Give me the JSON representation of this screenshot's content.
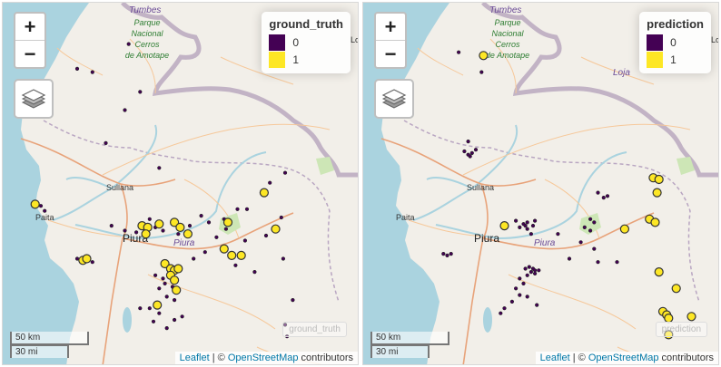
{
  "zoom": {
    "in_label": "+",
    "out_label": "−"
  },
  "scale": {
    "km": "50 km",
    "mi": "30 mi"
  },
  "attribution": {
    "leaflet": "Leaflet",
    "sep": " | © ",
    "osm": "OpenStreetMap",
    "suffix": " contributors"
  },
  "place_labels": {
    "tumbes": "Tumbes",
    "park": [
      "Parque",
      "Nacional",
      "Cerros",
      "de Amotape"
    ],
    "sullana": "Sullana",
    "paita": "Paita",
    "piura_city": "Piura",
    "piura_region": "Piura",
    "loja": "Loja",
    "lo": "Lo"
  },
  "colors": {
    "class_0": "#440154",
    "class_1": "#fde725",
    "accent": "#0078a8"
  },
  "maps": [
    {
      "name": "ground-truth",
      "legend_title": "ground_truth",
      "legend_items": [
        {
          "label": "0",
          "color": "#440154"
        },
        {
          "label": "1",
          "color": "#fde725"
        }
      ],
      "watermark": "ground_truth",
      "points_class_1": [
        [
          -4.77,
          -81.35
        ],
        [
          -4.88,
          -80.62
        ],
        [
          -4.9,
          -80.79
        ],
        [
          -4.91,
          -80.76
        ],
        [
          -4.89,
          -80.7
        ],
        [
          -4.95,
          -80.77
        ],
        [
          -4.91,
          -80.59
        ],
        [
          -4.95,
          -80.55
        ],
        [
          -4.88,
          -80.34
        ],
        [
          -4.7,
          -80.15
        ],
        [
          -5.11,
          -81.1
        ],
        [
          -5.1,
          -81.08
        ],
        [
          -5.04,
          -80.36
        ],
        [
          -5.08,
          -80.32
        ],
        [
          -5.08,
          -80.27
        ],
        [
          -5.13,
          -80.67
        ],
        [
          -5.16,
          -80.64
        ],
        [
          -5.17,
          -80.62
        ],
        [
          -5.16,
          -80.6
        ],
        [
          -5.2,
          -80.64
        ],
        [
          -5.23,
          -80.62
        ],
        [
          -5.29,
          -80.61
        ],
        [
          -5.38,
          -80.71
        ],
        [
          -4.92,
          -80.09
        ]
      ],
      "points_class_0": [
        [
          -3.8,
          -80.86
        ],
        [
          -3.95,
          -81.13
        ],
        [
          -4.4,
          -80.98
        ],
        [
          -4.55,
          -80.7
        ],
        [
          -4.78,
          -81.32
        ],
        [
          -4.81,
          -81.3
        ],
        [
          -4.9,
          -80.95
        ],
        [
          -4.93,
          -80.88
        ],
        [
          -4.94,
          -80.82
        ],
        [
          -4.86,
          -80.75
        ],
        [
          -4.91,
          -80.72
        ],
        [
          -4.84,
          -80.48
        ],
        [
          -4.88,
          -80.44
        ],
        [
          -4.93,
          -80.68
        ],
        [
          -4.95,
          -80.6
        ],
        [
          -4.9,
          -80.54
        ],
        [
          -4.86,
          -80.36
        ],
        [
          -4.97,
          -80.4
        ],
        [
          -4.99,
          -80.25
        ],
        [
          -4.92,
          -80.35
        ],
        [
          -5.1,
          -81.13
        ],
        [
          -5.12,
          -81.05
        ],
        [
          -5.06,
          -80.46
        ],
        [
          -5.1,
          -80.52
        ],
        [
          -5.09,
          -80.33
        ],
        [
          -5.14,
          -80.3
        ],
        [
          -5.18,
          -80.2
        ],
        [
          -5.2,
          -80.72
        ],
        [
          -5.22,
          -80.68
        ],
        [
          -5.25,
          -80.67
        ],
        [
          -5.27,
          -80.63
        ],
        [
          -5.28,
          -80.7
        ],
        [
          -5.33,
          -80.66
        ],
        [
          -5.35,
          -80.62
        ],
        [
          -5.4,
          -80.75
        ],
        [
          -5.43,
          -80.7
        ],
        [
          -5.48,
          -80.73
        ],
        [
          -5.47,
          -80.62
        ],
        [
          -5.45,
          -80.58
        ],
        [
          -5.52,
          -80.66
        ],
        [
          -5.4,
          -80.8
        ],
        [
          -4.8,
          -80.29
        ],
        [
          -4.8,
          -80.24
        ],
        [
          -4.64,
          -80.12
        ],
        [
          -4.58,
          -80.04
        ],
        [
          -4.85,
          -80.06
        ],
        [
          -4.96,
          -80.14
        ],
        [
          -5.1,
          -80.05
        ],
        [
          -5.35,
          -80.0
        ],
        [
          -5.5,
          -80.04
        ],
        [
          -5.57,
          -80.03
        ],
        [
          -4.2,
          -80.88
        ],
        [
          -3.97,
          -81.05
        ],
        [
          -4.09,
          -80.8
        ]
      ]
    },
    {
      "name": "prediction",
      "legend_title": "prediction",
      "legend_items": [
        {
          "label": "0",
          "color": "#440154"
        },
        {
          "label": "1",
          "color": "#fde725"
        }
      ],
      "watermark": "prediction",
      "points_class_1": [
        [
          -3.87,
          -80.89
        ],
        [
          -4.61,
          -80.0
        ],
        [
          -4.62,
          -79.97
        ],
        [
          -4.7,
          -79.98
        ],
        [
          -4.86,
          -80.02
        ],
        [
          -4.88,
          -79.99
        ],
        [
          -4.92,
          -80.15
        ],
        [
          -4.9,
          -80.78
        ],
        [
          -5.18,
          -79.97
        ],
        [
          -5.28,
          -79.88
        ],
        [
          -5.42,
          -79.95
        ],
        [
          -5.44,
          -79.93
        ],
        [
          -5.46,
          -79.92
        ],
        [
          -5.45,
          -79.8
        ],
        [
          -5.56,
          -79.92
        ]
      ],
      "points_class_0": [
        [
          -4.45,
          -80.99
        ],
        [
          -4.47,
          -80.97
        ],
        [
          -4.46,
          -80.95
        ],
        [
          -4.44,
          -80.93
        ],
        [
          -4.48,
          -80.96
        ],
        [
          -4.87,
          -80.72
        ],
        [
          -4.89,
          -80.68
        ],
        [
          -4.91,
          -80.7
        ],
        [
          -4.9,
          -80.67
        ],
        [
          -4.88,
          -80.66
        ],
        [
          -4.92,
          -80.66
        ],
        [
          -4.9,
          -80.63
        ],
        [
          -4.87,
          -80.62
        ],
        [
          -4.95,
          -80.64
        ],
        [
          -4.86,
          -80.33
        ],
        [
          -4.88,
          -80.31
        ],
        [
          -4.91,
          -80.36
        ],
        [
          -4.93,
          -80.33
        ],
        [
          -5.07,
          -81.06
        ],
        [
          -5.08,
          -81.08
        ],
        [
          -5.07,
          -81.1
        ],
        [
          -5.15,
          -80.65
        ],
        [
          -5.16,
          -80.63
        ],
        [
          -5.17,
          -80.62
        ],
        [
          -5.18,
          -80.64
        ],
        [
          -5.16,
          -80.67
        ],
        [
          -5.17,
          -80.6
        ],
        [
          -5.19,
          -80.62
        ],
        [
          -5.2,
          -80.66
        ],
        [
          -5.22,
          -80.7
        ],
        [
          -5.25,
          -80.68
        ],
        [
          -5.28,
          -80.72
        ],
        [
          -5.32,
          -80.7
        ],
        [
          -5.36,
          -80.74
        ],
        [
          -5.4,
          -80.78
        ],
        [
          -5.43,
          -80.8
        ],
        [
          -5.38,
          -80.61
        ],
        [
          -5.33,
          -80.66
        ],
        [
          -4.7,
          -80.29
        ],
        [
          -4.73,
          -80.26
        ],
        [
          -4.72,
          -80.24
        ],
        [
          -4.95,
          -80.5
        ],
        [
          -5.0,
          -80.38
        ],
        [
          -5.04,
          -80.31
        ],
        [
          -5.1,
          -80.44
        ],
        [
          -5.12,
          -80.19
        ],
        [
          -3.85,
          -81.02
        ],
        [
          -3.97,
          -80.9
        ],
        [
          -4.39,
          -80.97
        ],
        [
          -5.12,
          -80.29
        ]
      ]
    }
  ]
}
